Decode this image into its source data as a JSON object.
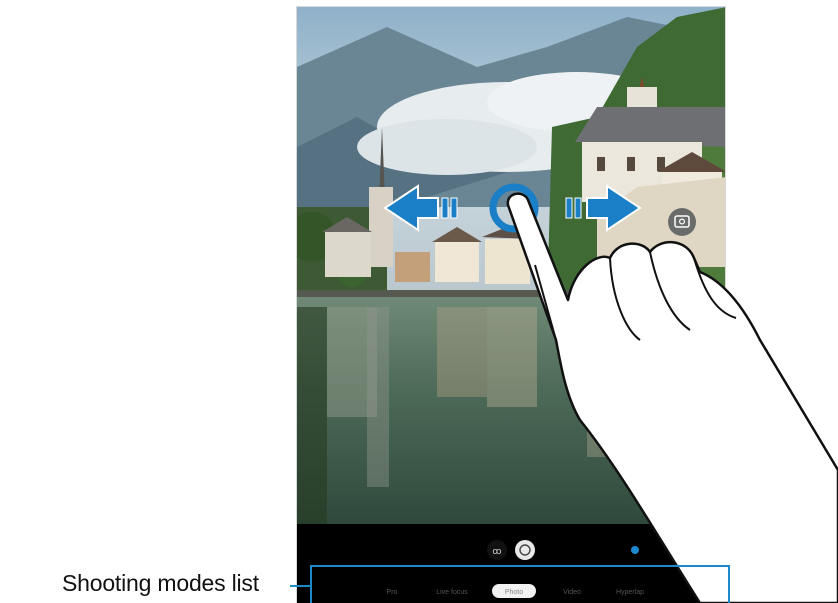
{
  "callout": {
    "label": "Shooting modes list"
  },
  "colors": {
    "callout_accent": "#1e88c8",
    "arrow_blue": "#1a7fc6",
    "bar": "#000000"
  },
  "icons": {
    "switch_camera": "camera-switch-icon",
    "effects": "effects-icon",
    "filter": "filter-icon",
    "gallery_dot": "gallery-preview-icon"
  },
  "gesture": {
    "description_icons": [
      "swipe-left-arrow-icon",
      "swipe-right-arrow-icon",
      "hand-icon"
    ]
  },
  "modes": {
    "items": [
      {
        "label": "Pro"
      },
      {
        "label": "Live focus"
      },
      {
        "label": "Photo",
        "selected": true
      },
      {
        "label": "Video"
      },
      {
        "label": "Hyperlap"
      }
    ]
  }
}
